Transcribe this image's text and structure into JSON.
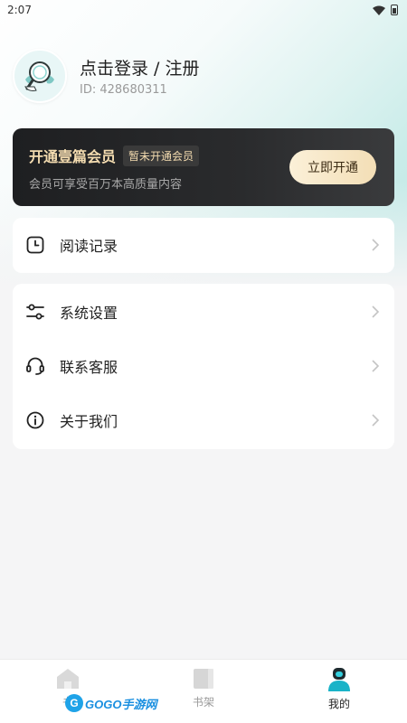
{
  "status_bar": {
    "time": "2:07"
  },
  "profile": {
    "login_text": "点击登录 / 注册",
    "user_id": "ID: 428680311"
  },
  "vip": {
    "title": "开通壹篇会员",
    "badge": "暂未开通会员",
    "description": "会员可享受百万本高质量内容",
    "button_label": "立即开通"
  },
  "menu_reading": {
    "label": "阅读记录",
    "icon": "clock-icon"
  },
  "menu_settings": [
    {
      "label": "系统设置",
      "icon": "sliders-icon"
    },
    {
      "label": "联系客服",
      "icon": "headset-icon"
    },
    {
      "label": "关于我们",
      "icon": "info-icon"
    }
  ],
  "bottom_nav": {
    "items": [
      {
        "label": "书",
        "icon": "home-icon",
        "active": false
      },
      {
        "label": "书架",
        "icon": "bookshelf-icon",
        "active": false
      },
      {
        "label": "我的",
        "icon": "profile-icon",
        "active": true
      }
    ]
  },
  "watermark": {
    "logo_letter": "G",
    "text": "GOGO手游网"
  },
  "colors": {
    "accent": "#1aa7c8",
    "vip_gold": "#f4dcb0",
    "vip_card_bg": "#1e1f21",
    "page_bg": "#f5f5f6"
  }
}
